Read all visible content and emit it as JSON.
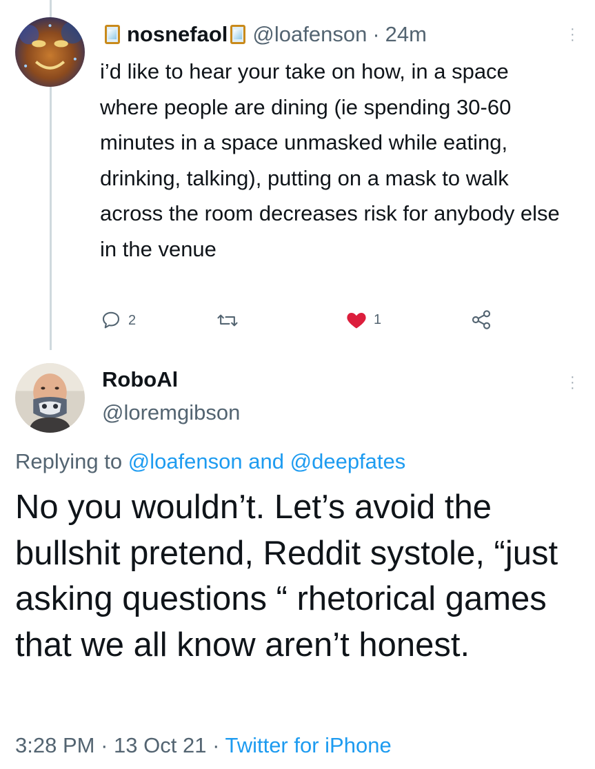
{
  "parent_tweet": {
    "display_name": "nosnefaol",
    "handle": "@loafenson",
    "separator": "·",
    "time": "24m",
    "text": "i’d like to hear your take on how, in a space where people are dining (ie spending 30-60 minutes in a space unmasked while eating, drinking, talking), putting on a mask to walk across the room decreases risk for anybody else in the venue",
    "reply_count": "2",
    "like_count": "1",
    "icons": {
      "reply": "comment-icon",
      "retweet": "retweet-icon",
      "like": "heart-filled-icon",
      "share": "share-icon",
      "name_emoji": "framed-picture-emoji-icon"
    }
  },
  "main_tweet": {
    "display_name": "RoboAl",
    "handle": "@loremgibson",
    "replying_prefix": "Replying to",
    "replying_user1": "@loafenson",
    "replying_and": "and",
    "replying_user2": "@deepfates",
    "text": "No you wouldn’t. Let’s avoid the bullshit pretend, Reddit systole, “just asking questions “ rhetorical games that we all know aren’t honest.",
    "time": "3:28 PM",
    "date": "13 Oct 21",
    "separator": "·",
    "source": "Twitter for iPhone"
  },
  "colors": {
    "link": "#1d9bf0",
    "secondary_text": "#536471",
    "primary_text": "#0f1419",
    "like": "#f91880",
    "thread_line": "#cfd9de"
  }
}
